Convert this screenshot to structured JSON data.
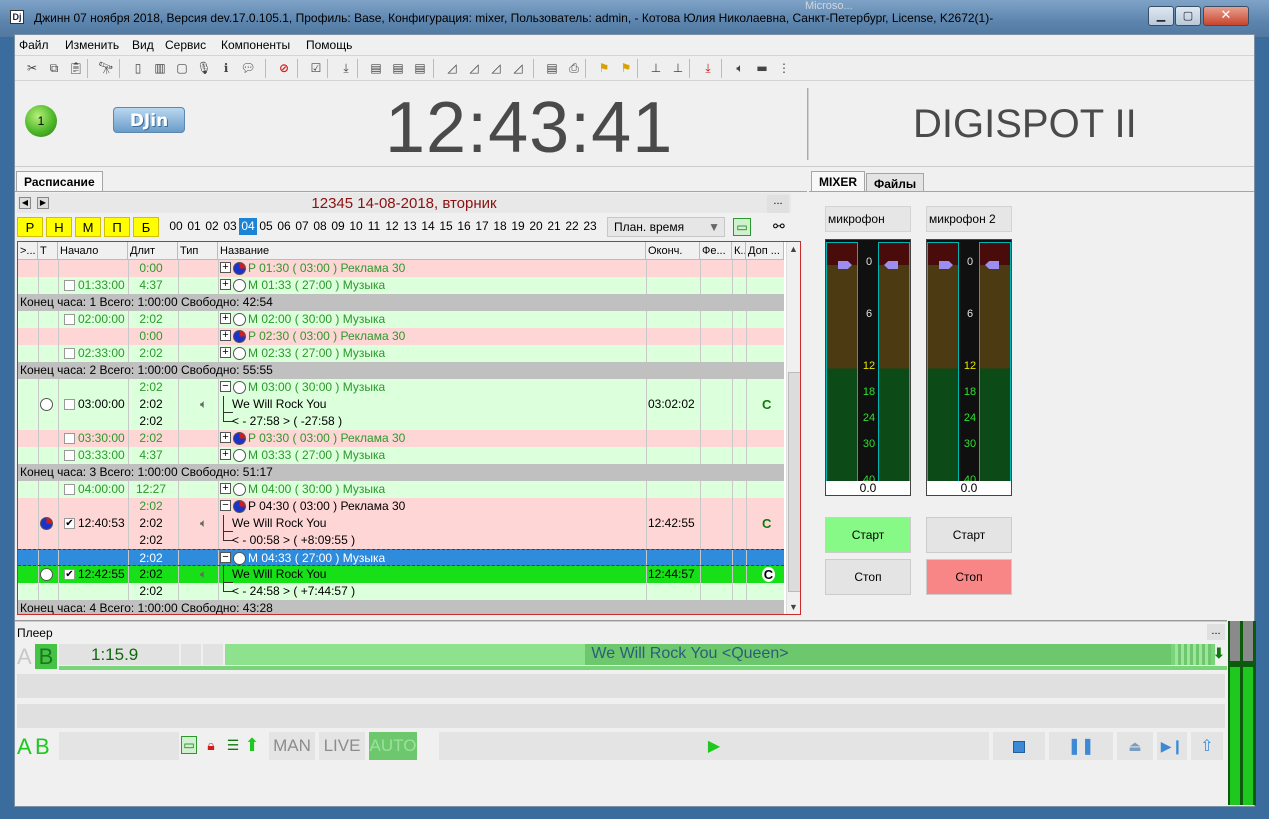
{
  "window": {
    "title": "Джинн 07 ноября 2018, Версия dev.17.0.105.1, Профиль: Base, Конфигурация: mixer, Пользователь: admin, - Котова Юлия Николаевна, Санкт-Петербург,  License, K2672(1)-",
    "background_task_text": "Microso..."
  },
  "menu": [
    "Файл",
    "Изменить",
    "Вид",
    "Сервис",
    "Компоненты",
    "Помощь"
  ],
  "header": {
    "indicator_value": "1",
    "logo_text": "DJin",
    "clock": "12:43:41",
    "brand": "DIGISPOT II"
  },
  "left_tab": "Расписание",
  "right_tabs": [
    "MIXER",
    "Файлы"
  ],
  "schedule": {
    "date": "12345 14-08-2018, вторник",
    "days": [
      "Р",
      "Н",
      "М",
      "П",
      "Б"
    ],
    "hours": [
      "00",
      "01",
      "02",
      "03",
      "04",
      "05",
      "06",
      "07",
      "08",
      "09",
      "10",
      "11",
      "12",
      "13",
      "14",
      "15",
      "16",
      "17",
      "18",
      "19",
      "20",
      "21",
      "22",
      "23"
    ],
    "active_hour": "04",
    "plan_select": "План. время",
    "more": "...",
    "columns": [
      ">...",
      "Т",
      "Начало",
      "Длит",
      "Тип",
      "Название",
      "Оконч.",
      "Фе...",
      "К..",
      "Доп ..."
    ],
    "rows": [
      {
        "style": "pink",
        "dur": "0:00",
        "icon": "pie",
        "name": "P 01:30 ( 03:00 ) Реклама 30",
        "color": "green"
      },
      {
        "style": "green",
        "start": "01:33:00",
        "dur": "4:37",
        "icon": "clock",
        "name": "M 01:33 ( 27:00 ) Музыка",
        "color": "green"
      },
      {
        "style": "gray",
        "summary": "Конец часа: 1 Всего: 1:00:00 Свободно: 42:54"
      },
      {
        "style": "green",
        "start": "02:00:00",
        "dur": "2:02",
        "icon": "clock",
        "name": "M 02:00 ( 30:00 ) Музыка",
        "color": "green"
      },
      {
        "style": "pink",
        "dur": "0:00",
        "icon": "pie",
        "name": "P 02:30 ( 03:00 ) Реклама 30",
        "color": "green"
      },
      {
        "style": "green",
        "start": "02:33:00",
        "dur": "2:02",
        "icon": "clock",
        "name": "M 02:33 ( 27:00 ) Музыка",
        "color": "green"
      },
      {
        "style": "gray",
        "summary": "Конец часа: 2 Всего: 1:00:00 Свободно: 55:55"
      },
      {
        "style": "green",
        "dur": "2:02",
        "icon": "clock",
        "minus": true,
        "name": "M 03:00 ( 30:00 ) Музыка",
        "color": "green"
      },
      {
        "style": "green",
        "lead": "clock",
        "start": "03:00:00",
        "dur": "2:02",
        "speaker": true,
        "sub": true,
        "name": "We Will Rock You",
        "end": "03:02:02",
        "c": "C",
        "color": "black"
      },
      {
        "style": "green",
        "dur": "2:02",
        "sub": true,
        "last": true,
        "name": "< - 27:58 > ( -27:58 )",
        "color": "black"
      },
      {
        "style": "pink",
        "start": "03:30:00",
        "dur": "2:02",
        "icon": "pie",
        "name": "P 03:30 ( 03:00 ) Реклама 30",
        "color": "green"
      },
      {
        "style": "green",
        "start": "03:33:00",
        "dur": "4:37",
        "icon": "clock",
        "name": "M 03:33 ( 27:00 ) Музыка",
        "color": "green"
      },
      {
        "style": "gray",
        "summary": "Конец часа: 3 Всего: 1:00:00 Свободно: 51:17"
      },
      {
        "style": "green",
        "start": "04:00:00",
        "dur": "12:27",
        "icon": "clock",
        "name": "M 04:00 ( 30:00 ) Музыка",
        "color": "green"
      },
      {
        "style": "pink",
        "dur": "2:02",
        "icon": "pie",
        "minus": true,
        "name": "P 04:30 ( 03:00 ) Реклама 30",
        "color": "black"
      },
      {
        "style": "pink",
        "lead": "pie",
        "checked": true,
        "start": "12:40:53",
        "dur": "2:02",
        "speaker": true,
        "sub": true,
        "name": "We Will Rock You",
        "end": "12:42:55",
        "c": "C",
        "color": "black"
      },
      {
        "style": "pink",
        "dur": "2:02",
        "sub": true,
        "last": true,
        "name": "< - 00:58 > ( +8:09:55 )",
        "color": "black"
      },
      {
        "style": "blue",
        "dur": "2:02",
        "icon": "clock",
        "minus": true,
        "name": "M 04:33 ( 27:00 ) Музыка",
        "color": "white"
      },
      {
        "style": "lime",
        "lead": "clock",
        "checked": true,
        "start": "12:42:55",
        "dur": "2:02",
        "speaker": true,
        "sub": true,
        "name": "We Will Rock You",
        "end": "12:44:57",
        "c": "C",
        "color": "black"
      },
      {
        "style": "green",
        "dur": "2:02",
        "sub": true,
        "last": true,
        "name": "< - 24:58 > ( +7:44:57 )",
        "color": "black"
      },
      {
        "style": "gray",
        "summary": "Конец часа: 4 Всего: 1:00:00 Свободно: 43:28"
      }
    ]
  },
  "mixer": {
    "channels": [
      {
        "label": "микрофон",
        "value": "0.0",
        "start": "Старт",
        "stop": "Стоп",
        "start_color": "#86f986",
        "stop_color": "#e4e4e4"
      },
      {
        "label": "микрофон 2",
        "value": "0.0",
        "start": "Старт",
        "stop": "Стоп",
        "start_color": "#e4e4e4",
        "stop_color": "#f98686"
      }
    ],
    "scale": [
      "0",
      "6",
      "12",
      "18",
      "24",
      "30",
      "40"
    ]
  },
  "player": {
    "title": "Плеер",
    "more": "...",
    "a": "A",
    "b": "B",
    "time": "1:15.9",
    "now_playing": "We Will Rock You <Queen>",
    "modes": [
      "MAN",
      "LIVE",
      "AUTO"
    ],
    "active_mode": "AUTO"
  }
}
